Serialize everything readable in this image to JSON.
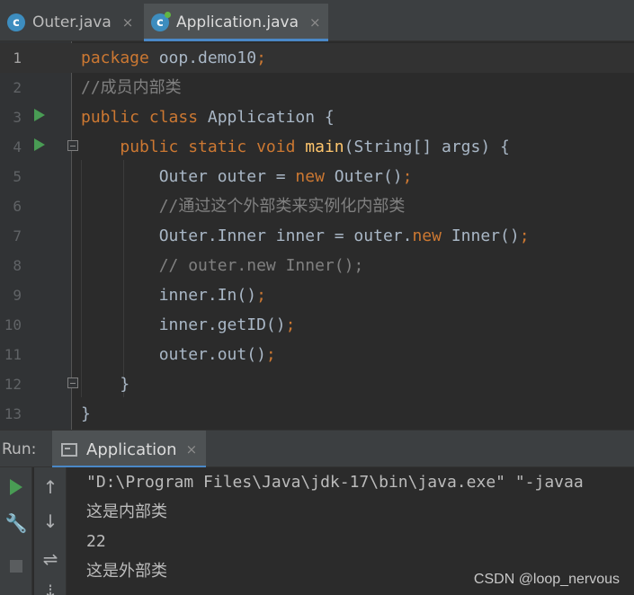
{
  "tabs": [
    {
      "label": "Outer.java",
      "icon": "java-class-icon",
      "active": false
    },
    {
      "label": "Application.java",
      "icon": "java-class-icon",
      "active": true
    }
  ],
  "close_glyph": "×",
  "editor": {
    "lines": [
      {
        "n": "1",
        "tokens": [
          {
            "t": "package",
            "c": "kw"
          },
          {
            "t": " oop.demo10"
          },
          {
            "t": ";",
            "c": "kw"
          }
        ]
      },
      {
        "n": "2",
        "tokens": [
          {
            "t": "//成员内部类",
            "c": "cm"
          }
        ]
      },
      {
        "n": "3",
        "tokens": [
          {
            "t": "public class",
            "c": "kw"
          },
          {
            "t": " Application {"
          }
        ]
      },
      {
        "n": "4",
        "tokens": [
          {
            "t": "    "
          },
          {
            "t": "public static void",
            "c": "kw"
          },
          {
            "t": " "
          },
          {
            "t": "main",
            "c": "fn"
          },
          {
            "t": "(String[] args) {"
          }
        ]
      },
      {
        "n": "5",
        "tokens": [
          {
            "t": "        Outer outer = "
          },
          {
            "t": "new",
            "c": "kw"
          },
          {
            "t": " Outer()"
          },
          {
            "t": ";",
            "c": "kw"
          }
        ]
      },
      {
        "n": "6",
        "tokens": [
          {
            "t": "        "
          },
          {
            "t": "//通过这个外部类来实例化内部类",
            "c": "cm"
          }
        ]
      },
      {
        "n": "7",
        "tokens": [
          {
            "t": "        Outer.Inner inner = outer."
          },
          {
            "t": "new",
            "c": "kw"
          },
          {
            "t": " Inner()"
          },
          {
            "t": ";",
            "c": "kw"
          }
        ]
      },
      {
        "n": "8",
        "tokens": [
          {
            "t": "        "
          },
          {
            "t": "// outer.new Inner();",
            "c": "cm"
          }
        ]
      },
      {
        "n": "9",
        "tokens": [
          {
            "t": "        inner.In()"
          },
          {
            "t": ";",
            "c": "kw"
          }
        ]
      },
      {
        "n": "10",
        "tokens": [
          {
            "t": "        inner.getID()"
          },
          {
            "t": ";",
            "c": "kw"
          }
        ]
      },
      {
        "n": "11",
        "tokens": [
          {
            "t": "        outer.out()"
          },
          {
            "t": ";",
            "c": "kw"
          }
        ]
      },
      {
        "n": "12",
        "tokens": [
          {
            "t": "    }"
          }
        ]
      },
      {
        "n": "13",
        "tokens": [
          {
            "t": "}"
          }
        ]
      }
    ]
  },
  "run": {
    "label": "Run:",
    "tab_label": "Application",
    "console_lines": [
      "\"D:\\Program Files\\Java\\jdk-17\\bin\\java.exe\" \"-javaa",
      "这是内部类",
      "22",
      "这是外部类"
    ]
  },
  "watermark": "CSDN @loop_nervous",
  "colors": {
    "keyword": "#cc7832",
    "function": "#ffc66d",
    "comment": "#808080",
    "text": "#a9b7c6",
    "run_green": "#499c54",
    "accent": "#4a88c7"
  }
}
